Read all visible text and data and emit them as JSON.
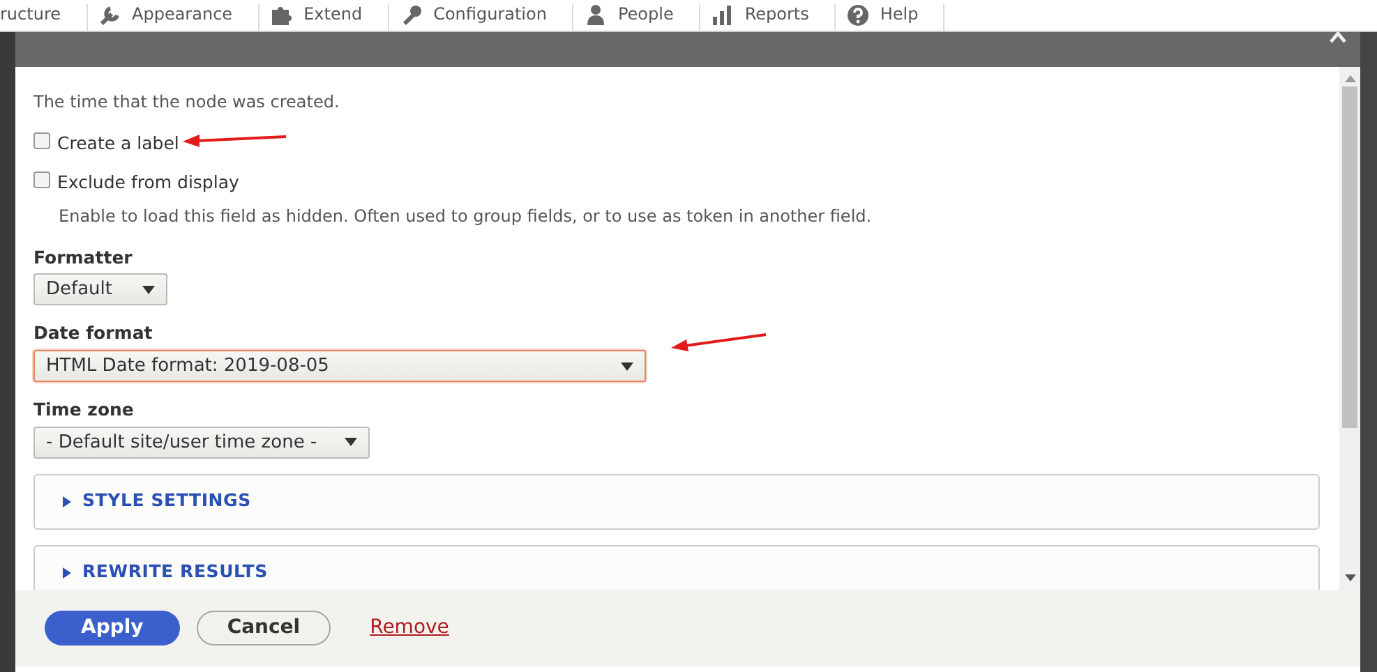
{
  "toolbar": {
    "items": [
      {
        "label": "ructure"
      },
      {
        "label": "Appearance"
      },
      {
        "label": "Extend"
      },
      {
        "label": "Configuration"
      },
      {
        "label": "People"
      },
      {
        "label": "Reports"
      },
      {
        "label": "Help"
      }
    ]
  },
  "dialog": {
    "description": "The time that the node was created.",
    "checkboxes": [
      {
        "label": "Create a label",
        "checked": false
      },
      {
        "label": "Exclude from display",
        "checked": false,
        "description": "Enable to load this field as hidden. Often used to group fields, or to use as token in another field."
      }
    ],
    "selects": [
      {
        "label": "Formatter",
        "value": "Default",
        "focused": false
      },
      {
        "label": "Date format",
        "value": "HTML Date format: 2019-08-05",
        "focused": true
      },
      {
        "label": "Time zone",
        "value": "- Default site/user time zone -",
        "focused": false
      }
    ],
    "details": [
      {
        "summary": "STYLE SETTINGS",
        "expanded": false
      },
      {
        "summary": "REWRITE RESULTS",
        "expanded": false
      }
    ],
    "buttons": [
      {
        "label": "Apply",
        "kind": "primary"
      },
      {
        "label": "Cancel",
        "kind": "secondary"
      },
      {
        "label": "Remove",
        "kind": "link"
      }
    ]
  }
}
